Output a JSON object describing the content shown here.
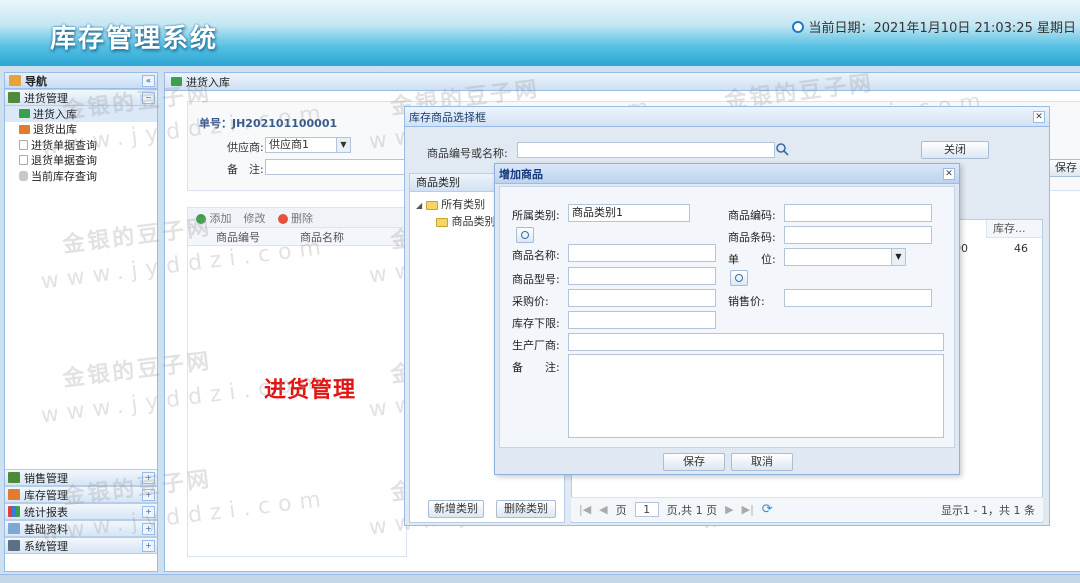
{
  "header": {
    "title": "库存管理系统",
    "date_text": "当前日期：2021年1月10日 21:03:25 星期日"
  },
  "sidebar": {
    "title": "导航",
    "groups": [
      {
        "label": "进货管理",
        "items": [
          "进货入库",
          "退货出库",
          "进货单据查询",
          "退货单据查询",
          "当前库存查询"
        ]
      }
    ],
    "collapsed_groups": [
      "销售管理",
      "库存管理",
      "统计报表",
      "基础资料",
      "系统管理"
    ]
  },
  "main": {
    "tab": "进货入库",
    "order_no": "单号：JH202101100001",
    "supplier_label": "供应商:",
    "supplier_value": "供应商1",
    "remark_label": "备　注:",
    "toolbar": {
      "add": "添加",
      "edit": "修改",
      "delete": "删除"
    },
    "columns": [
      "商品编号",
      "商品名称"
    ],
    "section_label": "进货管理",
    "save_btn": "保存"
  },
  "select_dialog": {
    "title": "库存商品选择框",
    "search_label": "商品编号或名称:",
    "close_btn": "关闭",
    "category_title": "商品类别",
    "tree_root": "所有类别",
    "tree_child": "商品类别",
    "add_category_btn": "新增类别",
    "delete_category_btn": "删除类别",
    "stock_header": "库存...",
    "stock_row_fragment": "00",
    "stock_value": "46",
    "pager_page_label": "页",
    "pager_page_value": "1",
    "pager_total": "页,共 1 页",
    "pager_summary": "显示1 - 1，共 1 条"
  },
  "add_dialog": {
    "title": "增加商品",
    "fields": {
      "category": {
        "label": "所属类别:",
        "value": "商品类别1"
      },
      "code": {
        "label": "商品编码:",
        "value": ""
      },
      "barcode": {
        "label": "商品条码:",
        "value": ""
      },
      "name": {
        "label": "商品名称:",
        "value": ""
      },
      "unit": {
        "label": "单　　位:",
        "value": ""
      },
      "model": {
        "label": "商品型号:",
        "value": ""
      },
      "purchase_price": {
        "label": "采购价:",
        "value": ""
      },
      "sale_price": {
        "label": "销售价:",
        "value": ""
      },
      "min_stock": {
        "label": "库存下限:",
        "value": ""
      },
      "manufacturer": {
        "label": "生产厂商:",
        "value": ""
      },
      "remark": {
        "label": "备　　注:",
        "value": ""
      }
    },
    "save_btn": "保存",
    "cancel_btn": "取消"
  },
  "watermark": {
    "line1": "金银的豆子网",
    "line2": "www.jyddzi.com"
  },
  "colors": {
    "header_accent": "#2aa6d4",
    "section_label": "#e41414",
    "border": "#99bbe8"
  }
}
